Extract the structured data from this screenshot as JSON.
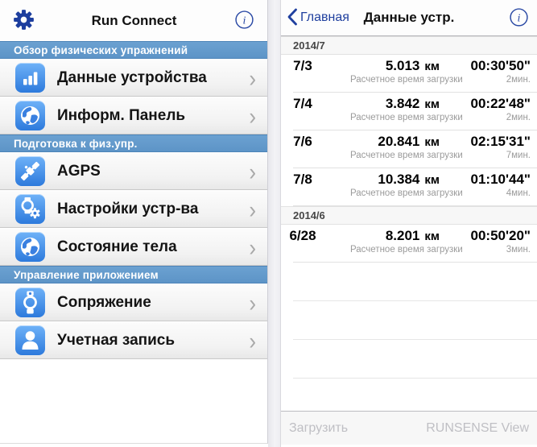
{
  "colors": {
    "accent_navy": "#1d3e9e",
    "section_blue": "#5d94c7",
    "tile_blue_top": "#6fb2f8",
    "tile_blue_bottom": "#2d7adc",
    "disabled_gray": "#bfbfc4"
  },
  "left": {
    "nav": {
      "title": "Run Connect",
      "settings_icon": "gear-icon",
      "info_icon": "info-icon"
    },
    "sections": [
      {
        "title": "Обзор физических упражнений",
        "items": [
          {
            "label": "Данные устройства",
            "icon": "bar-chart-icon"
          },
          {
            "label": "Информ. Панель",
            "icon": "globe-icon"
          }
        ]
      },
      {
        "title": "Подготовка к физ.упр.",
        "items": [
          {
            "label": "AGPS",
            "icon": "satellite-icon"
          },
          {
            "label": "Настройки устр-ва",
            "icon": "watch-gear-icon"
          },
          {
            "label": "Состояние тела",
            "icon": "globe-icon"
          }
        ]
      },
      {
        "title": "Управление приложением",
        "items": [
          {
            "label": "Сопряжение",
            "icon": "watch-icon"
          },
          {
            "label": "Учетная запись",
            "icon": "user-icon"
          }
        ]
      }
    ],
    "chevron": "›"
  },
  "right": {
    "nav": {
      "back": "Главная",
      "title": "Данные устр.",
      "info_icon": "info-icon"
    },
    "sections": [
      {
        "title": "2014/7",
        "rows": [
          {
            "date": "7/3",
            "distance": "5.013",
            "unit": "км",
            "time": "00:30'50\"",
            "sub": "Расчетное время загрузки",
            "load": "2мин."
          },
          {
            "date": "7/4",
            "distance": "3.842",
            "unit": "км",
            "time": "00:22'48\"",
            "sub": "Расчетное время загрузки",
            "load": "2мин."
          },
          {
            "date": "7/6",
            "distance": "20.841",
            "unit": "км",
            "time": "02:15'31\"",
            "sub": "Расчетное время загрузки",
            "load": "7мин."
          },
          {
            "date": "7/8",
            "distance": "10.384",
            "unit": "км",
            "time": "01:10'44\"",
            "sub": "Расчетное время загрузки",
            "load": "4мин."
          }
        ]
      },
      {
        "title": "2014/6",
        "rows": [
          {
            "date": "6/28",
            "distance": "8.201",
            "unit": "км",
            "time": "00:50'20\"",
            "sub": "Расчетное время загрузки",
            "load": "3мин."
          }
        ]
      }
    ],
    "toolbar": {
      "download": "Загрузить",
      "view": "RUNSENSE View"
    }
  }
}
